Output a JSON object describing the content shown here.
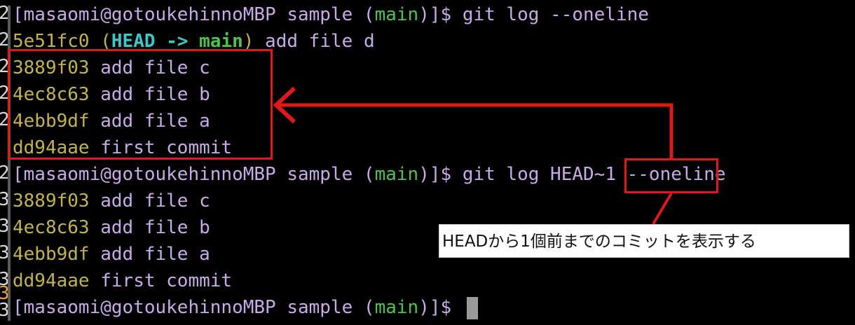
{
  "gutter": {
    "markers": [
      "2",
      "2",
      "2",
      "2",
      "2",
      "2",
      "3",
      "3",
      "3",
      "3",
      "3",
      "3"
    ],
    "current_index": 10
  },
  "session": {
    "prompt": "[masaomi@gotoukehinnoMBP sample (",
    "branch": "main",
    "prompt_suffix": ")]$ ",
    "commands": [
      {
        "text": "git log --oneline"
      },
      {
        "text_before": "git log ",
        "highlight": "HEAD~1",
        "text_after": " --oneline"
      }
    ],
    "head_commit": {
      "hash": "5e51fc0",
      "open": " (",
      "head_label": "HEAD -> ",
      "branch_label": "main",
      "close": ")",
      "message": " add file d"
    },
    "output_1": [
      {
        "hash": "3889f03",
        "message": " add file c"
      },
      {
        "hash": "4ec8c63",
        "message": " add file b"
      },
      {
        "hash": "4ebb9df",
        "message": " add file a"
      },
      {
        "hash": "dd94aae",
        "message": " first commit"
      }
    ],
    "output_2": [
      {
        "hash": "3889f03",
        "message": " add file c"
      },
      {
        "hash": "4ec8c63",
        "message": " add file b"
      },
      {
        "hash": "4ebb9df",
        "message": " add file a"
      },
      {
        "hash": "dd94aae",
        "message": " first commit"
      }
    ]
  },
  "annotation": {
    "callout_text": "HEADから1個前までのコミットを表示する",
    "color": "#e01818"
  },
  "colors": {
    "background": "#000000",
    "prompt": "#c9a9e9",
    "hash": "#c4b24a",
    "branch": "#4cc44c",
    "head_ref": "#3cc8c8",
    "cursor": "#9a9a9a"
  }
}
